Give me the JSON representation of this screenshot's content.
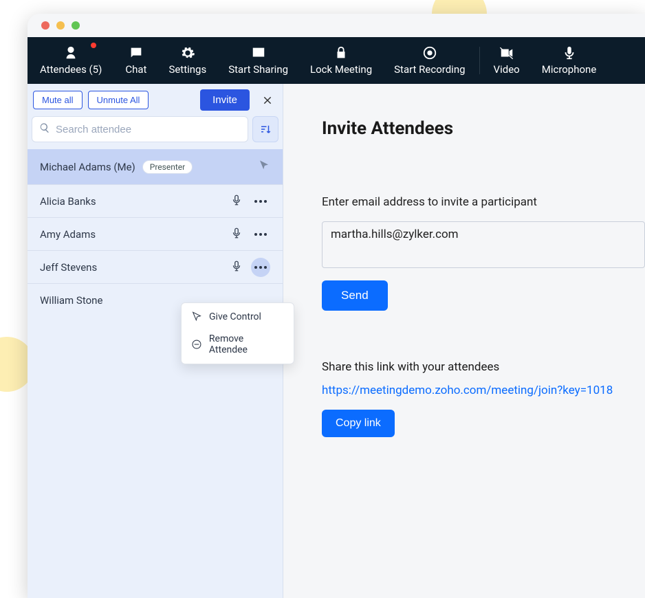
{
  "toolbar": {
    "attendees": "Attendees (5)",
    "chat": "Chat",
    "settings": "Settings",
    "share": "Start Sharing",
    "lock": "Lock Meeting",
    "record": "Start Recording",
    "video": "Video",
    "mic": "Microphone"
  },
  "panel": {
    "mute_all": "Mute all",
    "unmute_all": "Unmute All",
    "invite": "Invite",
    "search_placeholder": "Search attendee"
  },
  "attendees": [
    {
      "name": "Michael Adams (Me)",
      "badge": "Presenter",
      "is_me": true
    },
    {
      "name": "Alicia Banks"
    },
    {
      "name": "Amy Adams"
    },
    {
      "name": "Jeff Stevens",
      "menu_open": true
    },
    {
      "name": "William Stone"
    }
  ],
  "menu": {
    "give_control": "Give Control",
    "remove": "Remove Attendee"
  },
  "invite": {
    "title": "Invite Attendees",
    "email_label": "Enter email address to invite a participant",
    "email_value": "martha.hills@zylker.com",
    "send": "Send",
    "share_label": "Share this link with your attendees",
    "share_link": "https://meetingdemo.zoho.com/meeting/join?key=1018",
    "copy": "Copy link"
  }
}
